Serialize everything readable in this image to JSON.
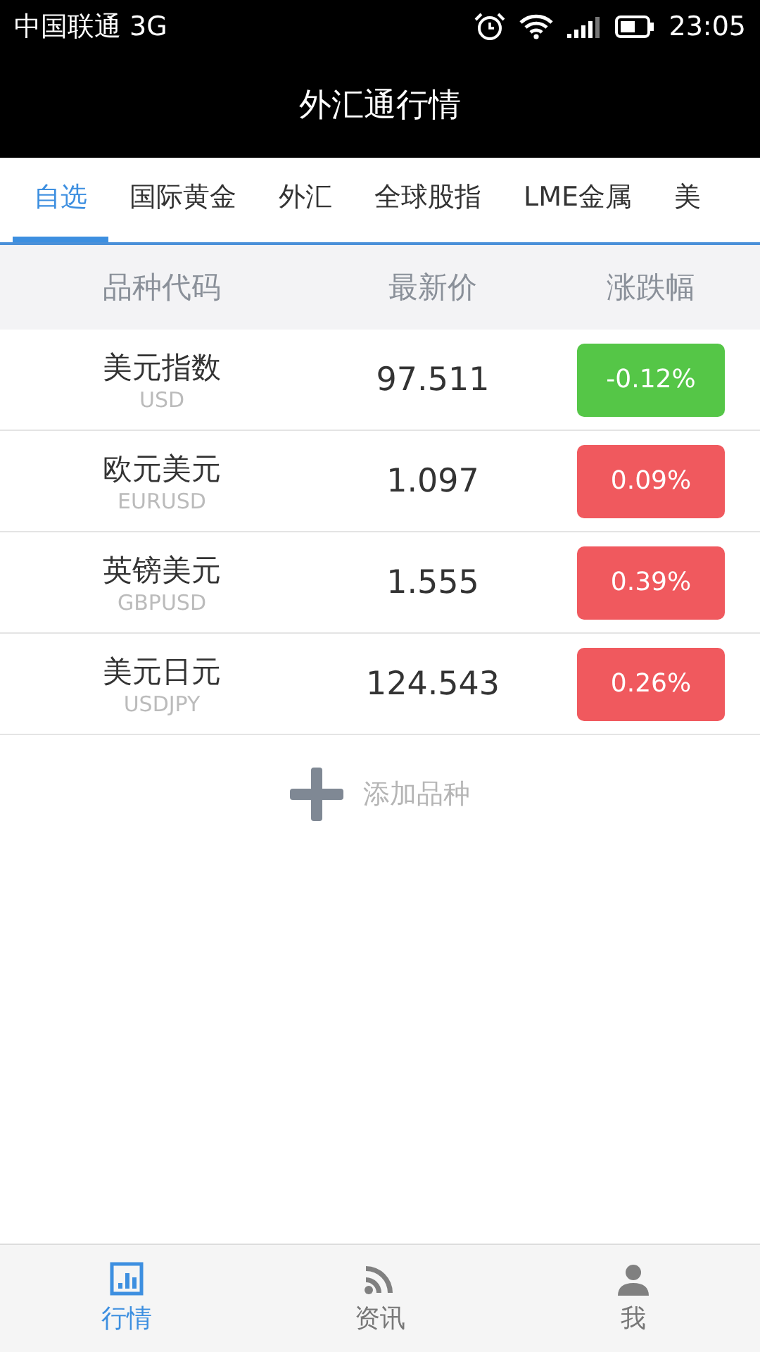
{
  "status_bar": {
    "carrier": "中国联通 3G",
    "time": "23:05"
  },
  "title": "外汇通行情",
  "tabs": [
    {
      "label": "自选",
      "selected": true
    },
    {
      "label": "国际黄金",
      "selected": false
    },
    {
      "label": "外汇",
      "selected": false
    },
    {
      "label": "全球股指",
      "selected": false
    },
    {
      "label": "LME金属",
      "selected": false
    },
    {
      "label": "美",
      "selected": false
    }
  ],
  "table": {
    "columns": [
      "品种代码",
      "最新价",
      "涨跌幅"
    ],
    "rows": [
      {
        "name": "美元指数",
        "code": "USD",
        "price": "97.511",
        "change": "-0.12%",
        "color": "#55c647"
      },
      {
        "name": "欧元美元",
        "code": "EURUSD",
        "price": "1.097",
        "change": "0.09%",
        "color": "#f0595e"
      },
      {
        "name": "英镑美元",
        "code": "GBPUSD",
        "price": "1.555",
        "change": "0.39%",
        "color": "#f0595e"
      },
      {
        "name": "美元日元",
        "code": "USDJPY",
        "price": "124.543",
        "change": "0.26%",
        "color": "#f0595e"
      }
    ]
  },
  "add_button": "添加品种",
  "bottom_nav": [
    {
      "label": "行情",
      "kind": "chart",
      "selected": true
    },
    {
      "label": "资讯",
      "kind": "feed",
      "selected": false
    },
    {
      "label": "我",
      "kind": "user",
      "selected": false
    }
  ]
}
